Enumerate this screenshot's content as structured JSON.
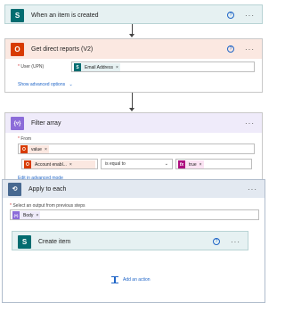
{
  "colors": {
    "sharepoint": "#036c70",
    "office": "#d83b01",
    "filter": "#8c6cd9",
    "loop": "#486991",
    "expr": "#ae0e7f",
    "link": "#1f65c7",
    "required": "#d13438"
  },
  "trigger": {
    "title": "When an item is created",
    "icon": "sharepoint-icon"
  },
  "get_reports": {
    "title": "Get direct reports (V2)",
    "icon": "office-icon",
    "user_label_required": "*",
    "user_label": "User (UPN)",
    "user_token": "Email Address",
    "show_advanced": "Show advanced options"
  },
  "filter": {
    "title": "Filter array",
    "icon": "filter-icon",
    "from_label_required": "*",
    "from_label": "From",
    "from_token": "value",
    "left_token": "Account enabl...",
    "operator": "is equal to",
    "right_token": "true",
    "edit_advanced": "Edit in advanced mode"
  },
  "apply": {
    "title": "Apply to each",
    "icon": "loop-icon",
    "select_label_required": "*",
    "select_label": "Select an output from previous steps",
    "body_token": "Body",
    "add_action": "Add an action",
    "help_glyph": "?",
    "more_glyph": "···"
  },
  "create_item": {
    "title": "Create item",
    "icon": "sharepoint-icon"
  },
  "ui": {
    "help_glyph": "?",
    "more_glyph": "···",
    "close_glyph": "×",
    "plus_glyph": "+",
    "chevron_glyph": "⌄"
  }
}
